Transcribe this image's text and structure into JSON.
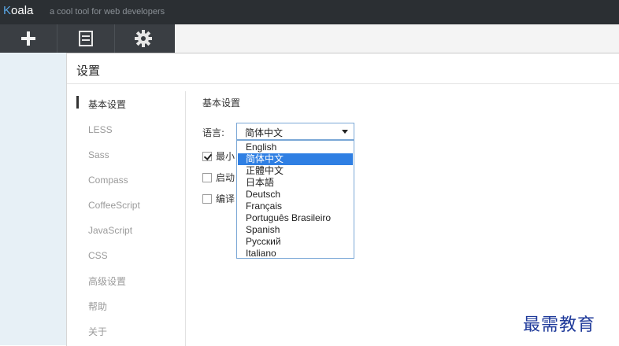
{
  "app": {
    "brand": "Koala",
    "brand_first": "K",
    "brand_rest": "oala",
    "tagline": "a cool tool for web developers"
  },
  "toolbar": {
    "buttons": [
      {
        "icon": "plus-icon"
      },
      {
        "icon": "document-icon"
      },
      {
        "icon": "gear-icon"
      }
    ]
  },
  "dialog": {
    "title": "设置",
    "nav": [
      {
        "label": "基本设置",
        "active": true
      },
      {
        "label": "LESS"
      },
      {
        "label": "Sass"
      },
      {
        "label": "Compass"
      },
      {
        "label": "CoffeeScript"
      },
      {
        "label": "JavaScript"
      },
      {
        "label": "CSS"
      },
      {
        "label": "高级设置"
      },
      {
        "label": "帮助"
      },
      {
        "label": "关于"
      }
    ],
    "section_title": "基本设置",
    "language": {
      "label": "语言:",
      "selected": "简体中文",
      "options": [
        "English",
        "简体中文",
        "正體中文",
        "日本語",
        "Deutsch",
        "Français",
        "Português Brasileiro",
        "Spanish",
        "Русский",
        "Italiano"
      ],
      "highlighted": "简体中文"
    },
    "options": [
      {
        "label": "最小",
        "checked": true
      },
      {
        "label": "启动",
        "checked": false
      },
      {
        "label": "编译",
        "checked": false
      }
    ]
  },
  "watermark": "最需教育"
}
